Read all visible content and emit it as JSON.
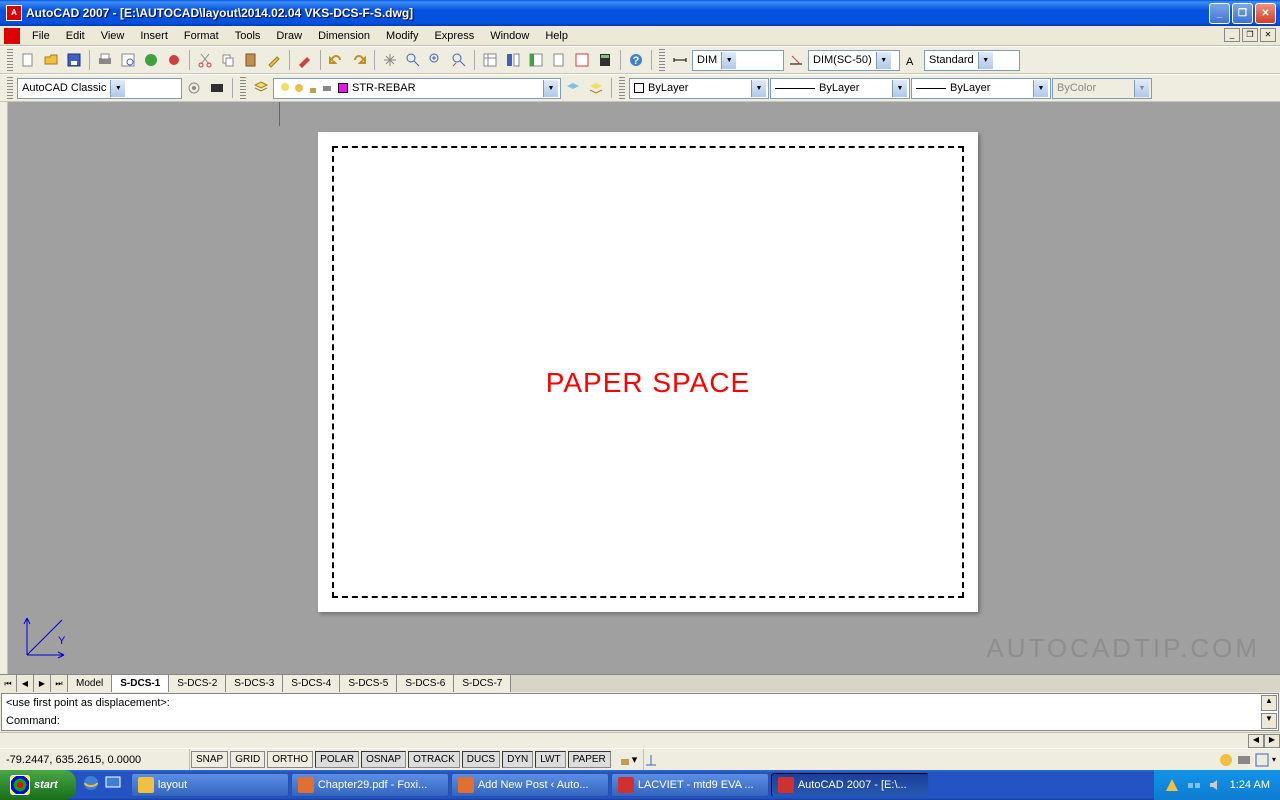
{
  "title": "AutoCAD 2007 - [E:\\AUTOCAD\\layout\\2014.02.04 VKS-DCS-F-S.dwg]",
  "menu": [
    "File",
    "Edit",
    "View",
    "Insert",
    "Format",
    "Tools",
    "Draw",
    "Dimension",
    "Modify",
    "Express",
    "Window",
    "Help"
  ],
  "toolbar2": {
    "workspace_combo": "AutoCAD Classic",
    "layer_combo": "STR-REBAR",
    "color_combo": "ByLayer",
    "linetype_combo": "ByLayer",
    "lineweight_combo": "ByLayer",
    "plotstyle_combo": "ByColor"
  },
  "toolbar1": {
    "dimstyle1": "DIM",
    "dimstyle2": "DIM(SC-50)",
    "textstyle": "Standard"
  },
  "canvas": {
    "paper_label": "PAPER SPACE",
    "watermark": "AUTOCADTIP.COM"
  },
  "layout_tabs": [
    "Model",
    "S-DCS-1",
    "S-DCS-2",
    "S-DCS-3",
    "S-DCS-4",
    "S-DCS-5",
    "S-DCS-6",
    "S-DCS-7"
  ],
  "command": {
    "line1": "<use first point as displacement>:",
    "line2": "Command:"
  },
  "status": {
    "coords": "-79.2447, 635.2615, 0.0000",
    "toggles": [
      "SNAP",
      "GRID",
      "ORTHO",
      "POLAR",
      "OSNAP",
      "OTRACK",
      "DUCS",
      "DYN",
      "LWT",
      "PAPER"
    ],
    "pressed": [
      "POLAR",
      "OSNAP",
      "OTRACK",
      "DUCS",
      "DYN",
      "LWT",
      "PAPER"
    ]
  },
  "taskbar": {
    "start": "start",
    "tasks": [
      {
        "label": "layout",
        "icon": "#f0c040"
      },
      {
        "label": "Chapter29.pdf - Foxi...",
        "icon": "#e07030"
      },
      {
        "label": "Add New Post ‹ Auto...",
        "icon": "#e07030"
      },
      {
        "label": "LACVIET - mtd9 EVA ...",
        "icon": "#d03030"
      },
      {
        "label": "AutoCAD 2007 - [E:\\...",
        "icon": "#d03030",
        "active": true
      }
    ],
    "clock": "1:24 AM"
  }
}
